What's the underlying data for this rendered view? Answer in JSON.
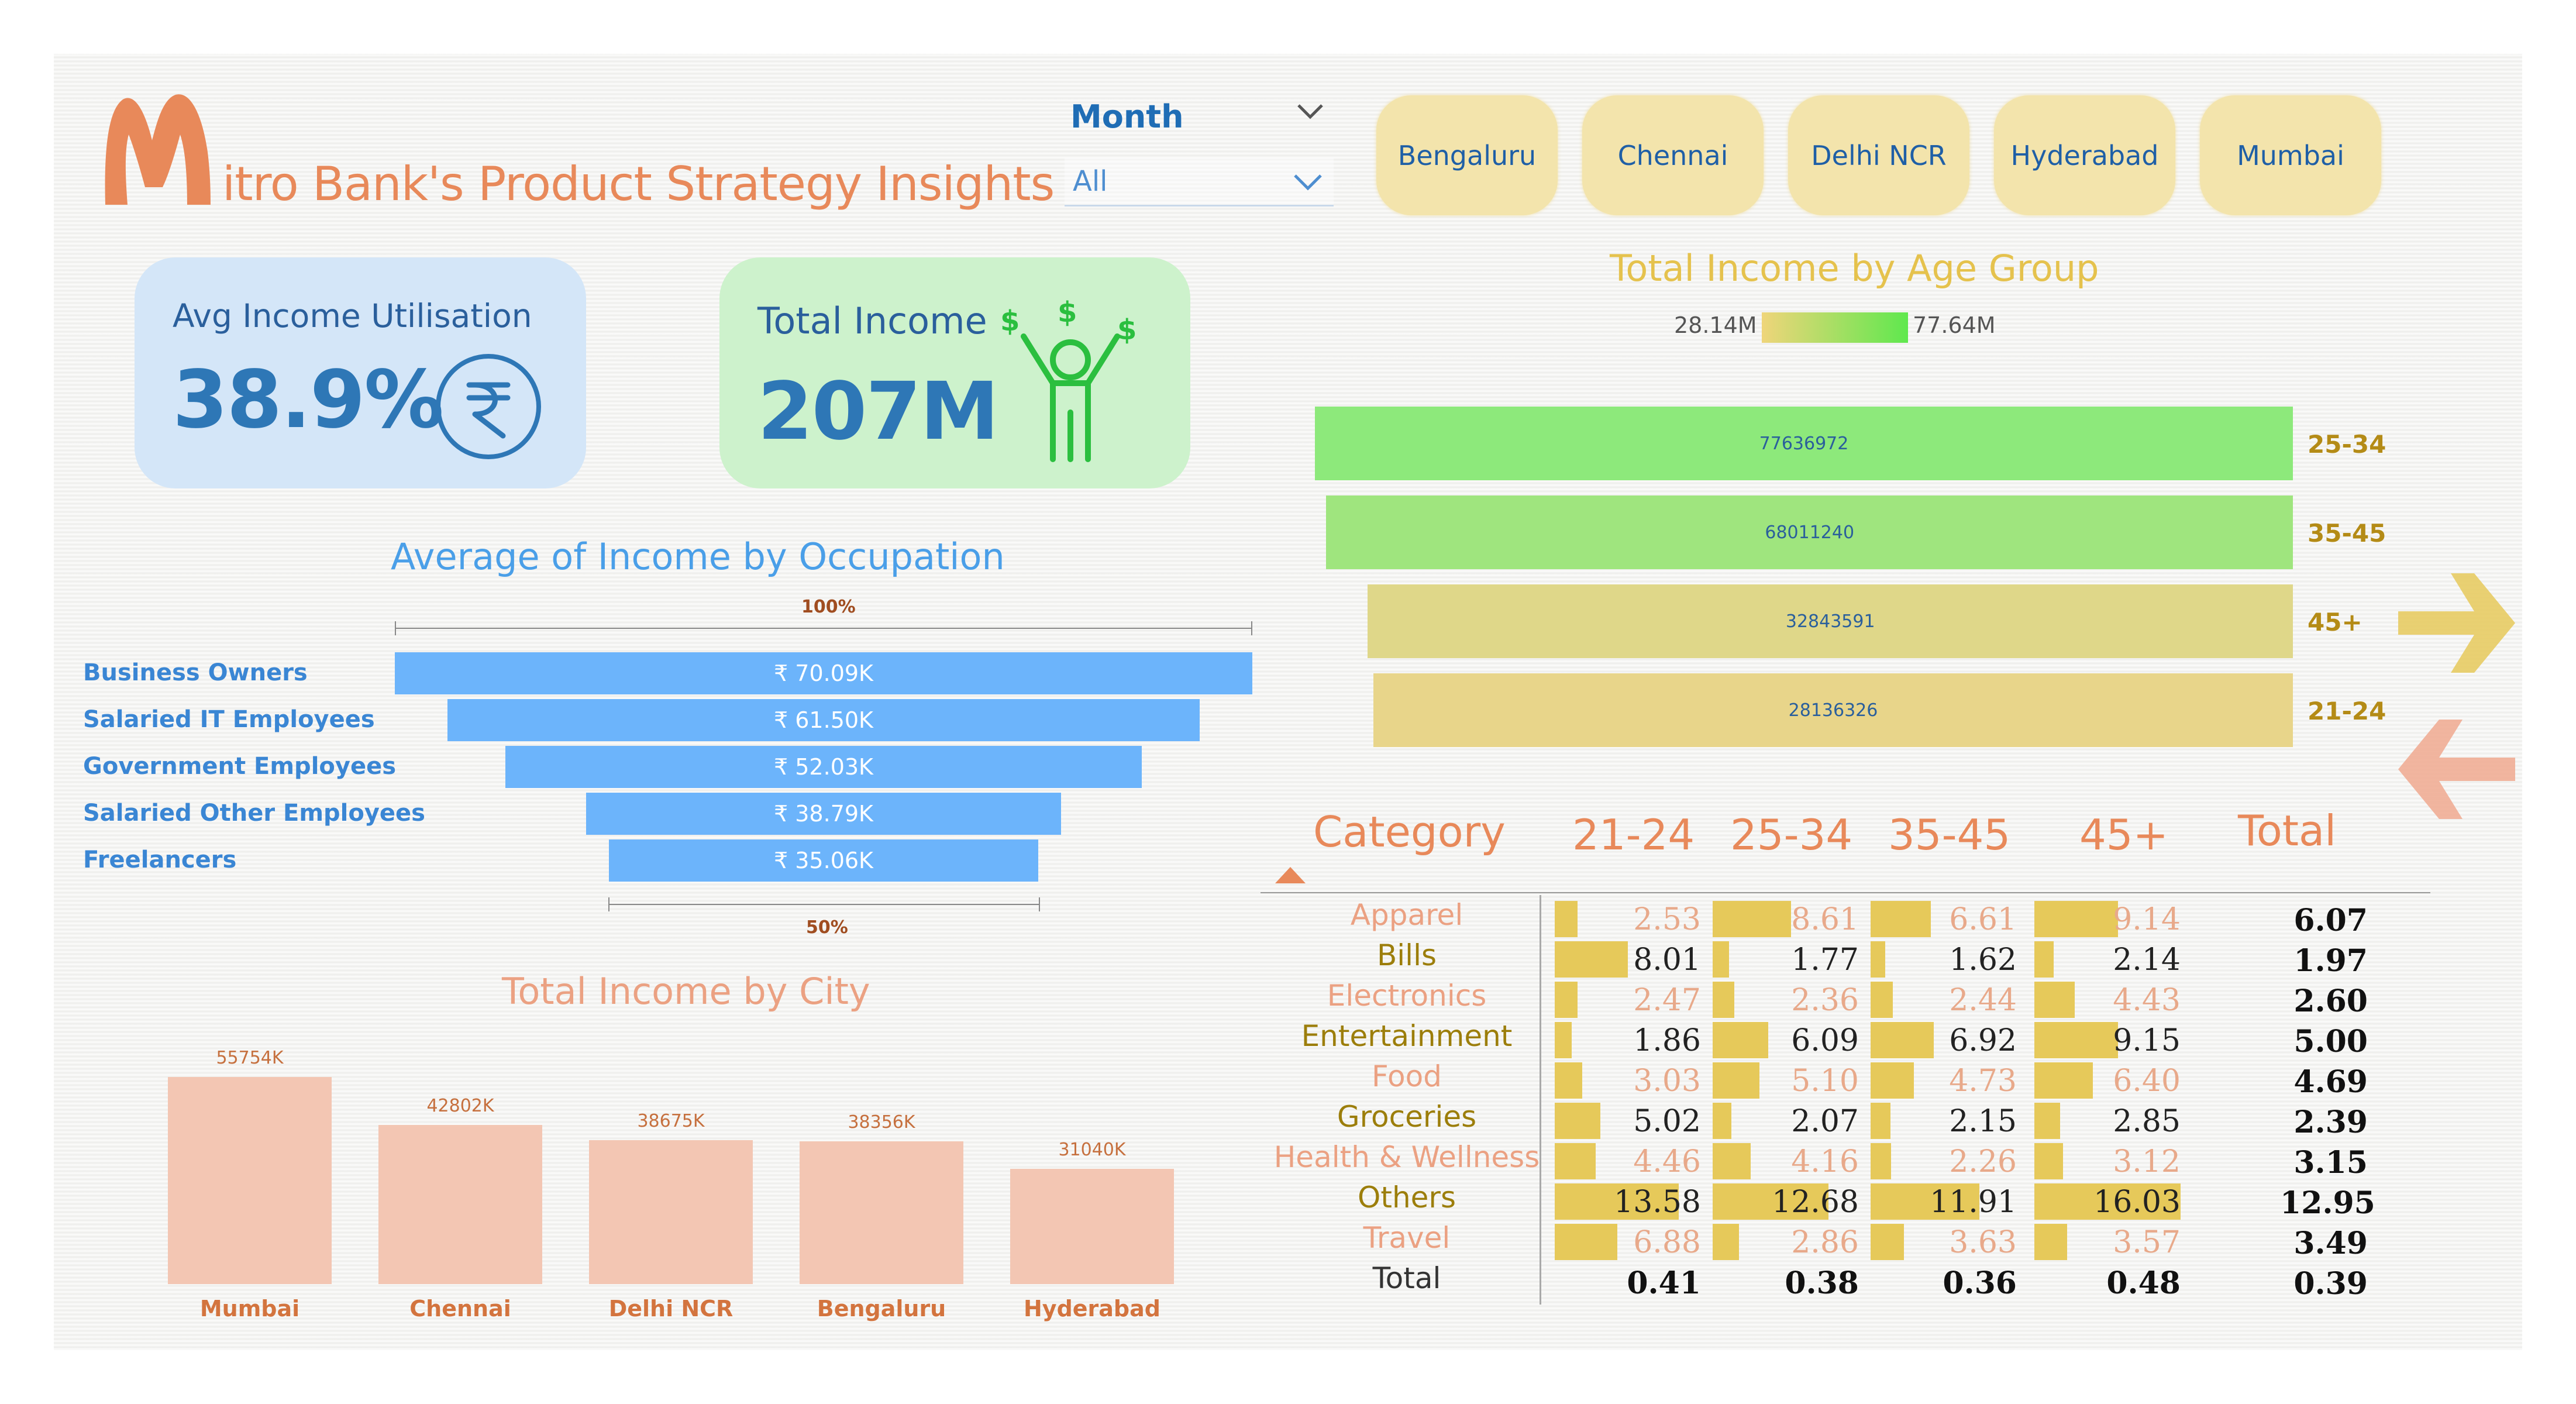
{
  "header": {
    "logo_letter": "M",
    "title": "itro Bank's Product Strategy Insights"
  },
  "month_slicer": {
    "label": "Month",
    "value": "All"
  },
  "city_buttons": [
    "Bengaluru",
    "Chennai",
    "Delhi NCR",
    "Hyderabad",
    "Mumbai"
  ],
  "kpis": {
    "avg_income_util": {
      "label": "Avg Income Utilisation",
      "value": "38.9%",
      "icon": "rupee-icon"
    },
    "total_income": {
      "label": "Total Income",
      "value": "207M",
      "icon": "happy-person-money-icon"
    }
  },
  "colors": {
    "accent_orange": "#e8895a",
    "funnel_blue": "#6cb4fb",
    "city_bar": "#f3c6b3",
    "age_green": "#8de97b",
    "age_yellow": "#e8d58a",
    "matrix_bar": "#e6c95a",
    "button_bg": "#f3e4ac"
  },
  "occupation_chart": {
    "title": "Average of Income by Occupation",
    "top_note": "100%",
    "bottom_note": "50%",
    "chart_data": {
      "type": "bar",
      "categories": [
        "Business Owners",
        "Salaried IT Employees",
        "Government Employees",
        "Salaried Other Employees",
        "Freelancers"
      ],
      "values": [
        70090,
        61500,
        52030,
        38790,
        35060
      ],
      "labels": [
        "₹ 70.09K",
        "₹ 61.50K",
        "₹ 52.03K",
        "₹ 38.79K",
        "₹ 35.06K"
      ]
    }
  },
  "city_chart": {
    "title": "Total Income by City",
    "chart_data": {
      "type": "bar",
      "categories": [
        "Mumbai",
        "Chennai",
        "Delhi NCR",
        "Bengaluru",
        "Hyderabad"
      ],
      "values": [
        55754,
        42802,
        38675,
        38356,
        31040
      ],
      "labels": [
        "55754K",
        "42802K",
        "38675K",
        "38356K",
        "31040K"
      ]
    }
  },
  "age_chart": {
    "title": "Total Income by Age Group",
    "legend_min": "28.14M",
    "legend_max": "77.64M",
    "chart_data": {
      "type": "bar",
      "categories": [
        "25-34",
        "35-45",
        "45+",
        "21-24"
      ],
      "values": [
        77636972,
        68011240,
        32843591,
        28136326
      ],
      "labels": [
        "77636972",
        "68011240",
        "32843591",
        "28136326"
      ]
    }
  },
  "matrix": {
    "headers": [
      "Category",
      "21-24",
      "25-34",
      "35-45",
      "45+",
      "Total"
    ],
    "rows": [
      {
        "category": "Apparel",
        "values": [
          "2.53",
          "8.61",
          "6.61",
          "9.14"
        ],
        "total": "6.07"
      },
      {
        "category": "Bills",
        "values": [
          "8.01",
          "1.77",
          "1.62",
          "2.14"
        ],
        "total": "1.97"
      },
      {
        "category": "Electronics",
        "values": [
          "2.47",
          "2.36",
          "2.44",
          "4.43"
        ],
        "total": "2.60"
      },
      {
        "category": "Entertainment",
        "values": [
          "1.86",
          "6.09",
          "6.92",
          "9.15"
        ],
        "total": "5.00"
      },
      {
        "category": "Food",
        "values": [
          "3.03",
          "5.10",
          "4.73",
          "6.40"
        ],
        "total": "4.69"
      },
      {
        "category": "Groceries",
        "values": [
          "5.02",
          "2.07",
          "2.15",
          "2.85"
        ],
        "total": "2.39"
      },
      {
        "category": "Health & Wellness",
        "values": [
          "4.46",
          "4.16",
          "2.26",
          "3.12"
        ],
        "total": "3.15"
      },
      {
        "category": "Others",
        "values": [
          "13.58",
          "12.68",
          "11.91",
          "16.03"
        ],
        "total": "12.95"
      },
      {
        "category": "Travel",
        "values": [
          "6.88",
          "2.86",
          "3.63",
          "3.57"
        ],
        "total": "3.49"
      }
    ],
    "total_row": {
      "category": "Total",
      "values": [
        "0.41",
        "0.38",
        "0.36",
        "0.48"
      ],
      "total": "0.39"
    }
  },
  "nav": {
    "next_icon": "arrow-right-icon",
    "prev_icon": "arrow-left-icon"
  }
}
